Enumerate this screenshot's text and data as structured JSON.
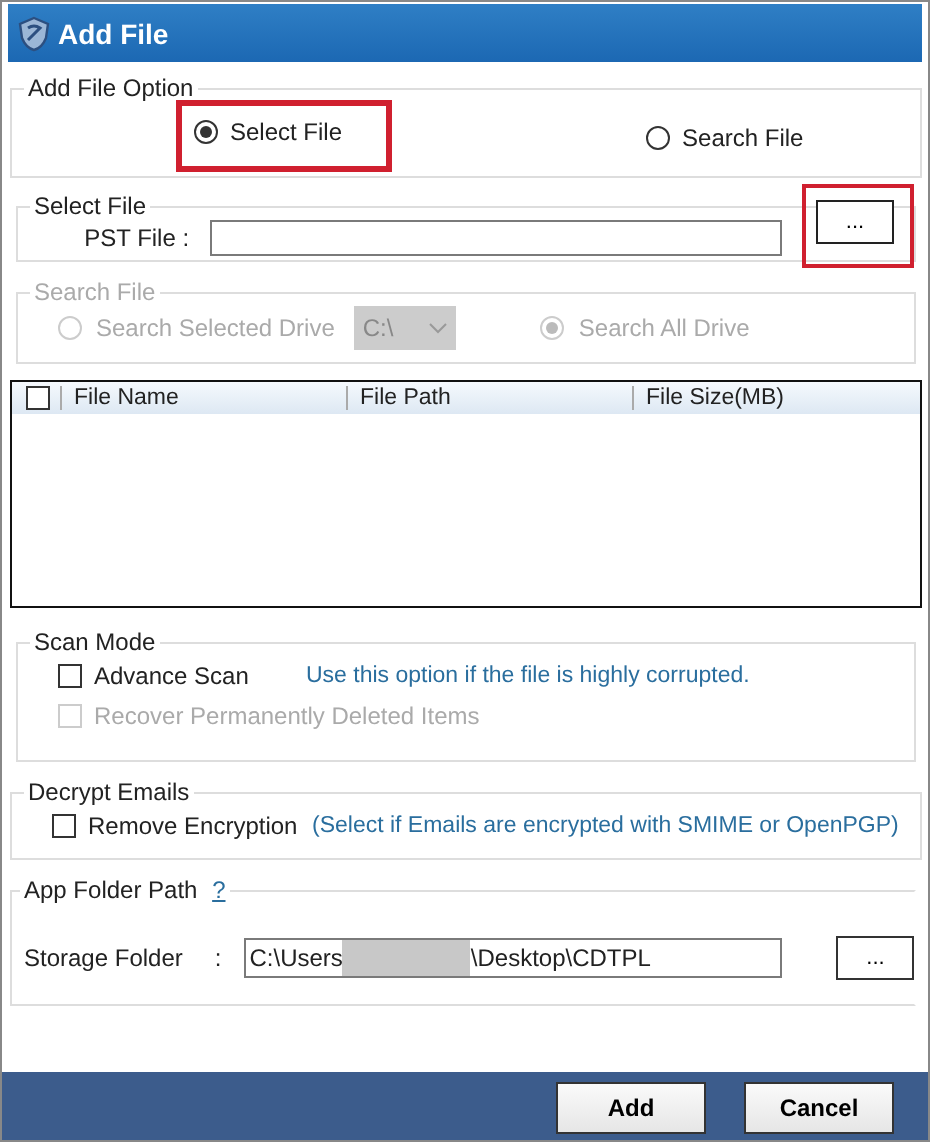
{
  "window": {
    "title": "Add File"
  },
  "add_file_option": {
    "legend": "Add File Option",
    "options": [
      {
        "label": "Select File",
        "selected": true,
        "highlighted": true
      },
      {
        "label": "Search File",
        "selected": false,
        "highlighted": false
      }
    ]
  },
  "select_file": {
    "legend": "Select File",
    "label": "PST File :",
    "browse": {
      "label": "...",
      "highlighted": true
    }
  },
  "search_file": {
    "legend": "Search File",
    "disabled": true,
    "options": [
      {
        "label": "Search Selected Drive",
        "selected": false
      },
      {
        "label": "Search All Drive",
        "selected": true
      }
    ],
    "drive": "C:\\"
  },
  "table": {
    "columns": [
      "File Name",
      "File Path",
      "File Size(MB)"
    ],
    "select_all": false
  },
  "scan_mode": {
    "legend": "Scan Mode",
    "options": [
      {
        "label": "Advance Scan",
        "checked": false,
        "disabled": false,
        "hint": "Use this option if the file is highly corrupted."
      },
      {
        "label": "Recover Permanently Deleted Items",
        "checked": false,
        "disabled": true
      }
    ]
  },
  "decrypt": {
    "legend": "Decrypt Emails",
    "label": "Remove Encryption",
    "checked": false,
    "hint": "(Select if Emails are encrypted with SMIME or OpenPGP)"
  },
  "app_folder": {
    "legend": "App Folder Path",
    "help": "?",
    "label": "Storage Folder",
    "separator": ":",
    "value_parts": [
      "C:\\Users",
      "\\Desktop\\CDTPL"
    ],
    "redacted": true,
    "browse": "..."
  },
  "buttons": [
    "Add",
    "Cancel"
  ]
}
